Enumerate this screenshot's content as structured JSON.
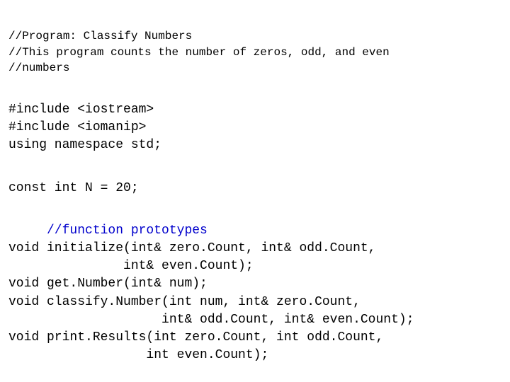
{
  "comments": {
    "line1": "//Program: Classify Numbers",
    "line2": "//This program counts the number of zeros, odd, and even",
    "line3": "//numbers"
  },
  "includes": {
    "line1": "#include <iostream>",
    "line2": "#include <iomanip>",
    "line3": "using namespace std;"
  },
  "const_line": "const int N = 20;",
  "proto_comment": "     //function prototypes",
  "protos": {
    "line1": "void initialize(int& zero.Count, int& odd.Count, ",
    "line2": "               int& even.Count);",
    "line3": "void get.Number(int& num);",
    "line4": "void classify.Number(int num, int& zero.Count, ",
    "line5": "                    int& odd.Count, int& even.Count);",
    "line6": "void print.Results(int zero.Count, int odd.Count, ",
    "line7": "                  int even.Count);"
  }
}
